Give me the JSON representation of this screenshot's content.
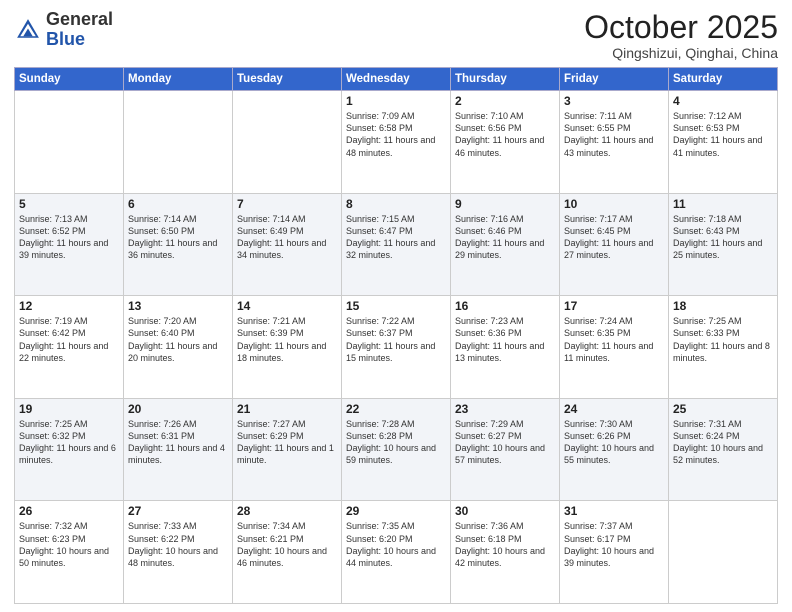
{
  "logo": {
    "general": "General",
    "blue": "Blue"
  },
  "header": {
    "month": "October 2025",
    "location": "Qingshizui, Qinghai, China"
  },
  "weekdays": [
    "Sunday",
    "Monday",
    "Tuesday",
    "Wednesday",
    "Thursday",
    "Friday",
    "Saturday"
  ],
  "weeks": [
    [
      {
        "day": "",
        "info": ""
      },
      {
        "day": "",
        "info": ""
      },
      {
        "day": "",
        "info": ""
      },
      {
        "day": "1",
        "info": "Sunrise: 7:09 AM\nSunset: 6:58 PM\nDaylight: 11 hours\nand 48 minutes."
      },
      {
        "day": "2",
        "info": "Sunrise: 7:10 AM\nSunset: 6:56 PM\nDaylight: 11 hours\nand 46 minutes."
      },
      {
        "day": "3",
        "info": "Sunrise: 7:11 AM\nSunset: 6:55 PM\nDaylight: 11 hours\nand 43 minutes."
      },
      {
        "day": "4",
        "info": "Sunrise: 7:12 AM\nSunset: 6:53 PM\nDaylight: 11 hours\nand 41 minutes."
      }
    ],
    [
      {
        "day": "5",
        "info": "Sunrise: 7:13 AM\nSunset: 6:52 PM\nDaylight: 11 hours\nand 39 minutes."
      },
      {
        "day": "6",
        "info": "Sunrise: 7:14 AM\nSunset: 6:50 PM\nDaylight: 11 hours\nand 36 minutes."
      },
      {
        "day": "7",
        "info": "Sunrise: 7:14 AM\nSunset: 6:49 PM\nDaylight: 11 hours\nand 34 minutes."
      },
      {
        "day": "8",
        "info": "Sunrise: 7:15 AM\nSunset: 6:47 PM\nDaylight: 11 hours\nand 32 minutes."
      },
      {
        "day": "9",
        "info": "Sunrise: 7:16 AM\nSunset: 6:46 PM\nDaylight: 11 hours\nand 29 minutes."
      },
      {
        "day": "10",
        "info": "Sunrise: 7:17 AM\nSunset: 6:45 PM\nDaylight: 11 hours\nand 27 minutes."
      },
      {
        "day": "11",
        "info": "Sunrise: 7:18 AM\nSunset: 6:43 PM\nDaylight: 11 hours\nand 25 minutes."
      }
    ],
    [
      {
        "day": "12",
        "info": "Sunrise: 7:19 AM\nSunset: 6:42 PM\nDaylight: 11 hours\nand 22 minutes."
      },
      {
        "day": "13",
        "info": "Sunrise: 7:20 AM\nSunset: 6:40 PM\nDaylight: 11 hours\nand 20 minutes."
      },
      {
        "day": "14",
        "info": "Sunrise: 7:21 AM\nSunset: 6:39 PM\nDaylight: 11 hours\nand 18 minutes."
      },
      {
        "day": "15",
        "info": "Sunrise: 7:22 AM\nSunset: 6:37 PM\nDaylight: 11 hours\nand 15 minutes."
      },
      {
        "day": "16",
        "info": "Sunrise: 7:23 AM\nSunset: 6:36 PM\nDaylight: 11 hours\nand 13 minutes."
      },
      {
        "day": "17",
        "info": "Sunrise: 7:24 AM\nSunset: 6:35 PM\nDaylight: 11 hours\nand 11 minutes."
      },
      {
        "day": "18",
        "info": "Sunrise: 7:25 AM\nSunset: 6:33 PM\nDaylight: 11 hours\nand 8 minutes."
      }
    ],
    [
      {
        "day": "19",
        "info": "Sunrise: 7:25 AM\nSunset: 6:32 PM\nDaylight: 11 hours\nand 6 minutes."
      },
      {
        "day": "20",
        "info": "Sunrise: 7:26 AM\nSunset: 6:31 PM\nDaylight: 11 hours\nand 4 minutes."
      },
      {
        "day": "21",
        "info": "Sunrise: 7:27 AM\nSunset: 6:29 PM\nDaylight: 11 hours\nand 1 minute."
      },
      {
        "day": "22",
        "info": "Sunrise: 7:28 AM\nSunset: 6:28 PM\nDaylight: 10 hours\nand 59 minutes."
      },
      {
        "day": "23",
        "info": "Sunrise: 7:29 AM\nSunset: 6:27 PM\nDaylight: 10 hours\nand 57 minutes."
      },
      {
        "day": "24",
        "info": "Sunrise: 7:30 AM\nSunset: 6:26 PM\nDaylight: 10 hours\nand 55 minutes."
      },
      {
        "day": "25",
        "info": "Sunrise: 7:31 AM\nSunset: 6:24 PM\nDaylight: 10 hours\nand 52 minutes."
      }
    ],
    [
      {
        "day": "26",
        "info": "Sunrise: 7:32 AM\nSunset: 6:23 PM\nDaylight: 10 hours\nand 50 minutes."
      },
      {
        "day": "27",
        "info": "Sunrise: 7:33 AM\nSunset: 6:22 PM\nDaylight: 10 hours\nand 48 minutes."
      },
      {
        "day": "28",
        "info": "Sunrise: 7:34 AM\nSunset: 6:21 PM\nDaylight: 10 hours\nand 46 minutes."
      },
      {
        "day": "29",
        "info": "Sunrise: 7:35 AM\nSunset: 6:20 PM\nDaylight: 10 hours\nand 44 minutes."
      },
      {
        "day": "30",
        "info": "Sunrise: 7:36 AM\nSunset: 6:18 PM\nDaylight: 10 hours\nand 42 minutes."
      },
      {
        "day": "31",
        "info": "Sunrise: 7:37 AM\nSunset: 6:17 PM\nDaylight: 10 hours\nand 39 minutes."
      },
      {
        "day": "",
        "info": ""
      }
    ]
  ]
}
